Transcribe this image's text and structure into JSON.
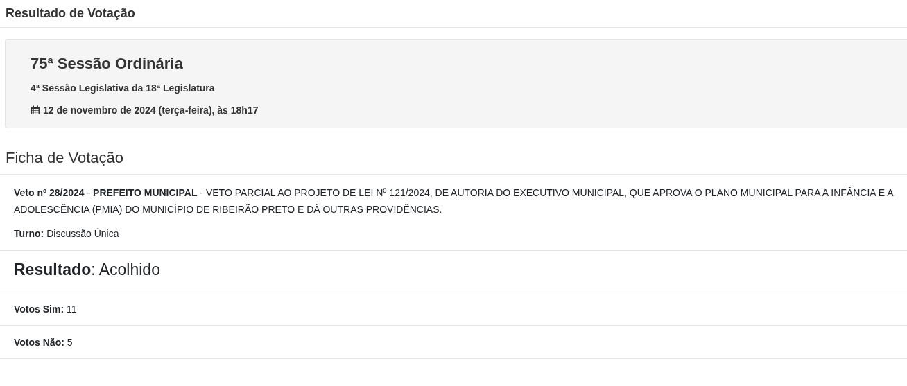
{
  "page_title": "Resultado de Votação",
  "session": {
    "title": "75ª Sessão Ordinária",
    "subtitle": "4ª Sessão Legislativa da 18ª Legislatura",
    "date": "12 de novembro de 2024 (terça-feira), às 18h17"
  },
  "ficha": {
    "title": "Ficha de Votação",
    "description": "**Veto nº 28/2024** - **PREFEITO MUNICIPAL** - VETO PARCIAL AO PROJETO DE LEI Nº 121/2024, DE AUTORIA DO EXECUTIVO MUNICIPAL, QUE APROVA O PLANO MUNICIPAL PARA A INFÂNCIA E A ADOLESCÊNCIA (PMIA) DO MUNICÍPIO DE RIBEIRÃO PRETO E DÁ OUTRAS PROVIDÊNCIAS.",
    "turno": "**Turno:** Discussão Única",
    "resultado": "**Resultado**: Acolhido",
    "votes": [
      {
        "text": "**Votos Sim:** 11"
      },
      {
        "text": "**Votos Não:** 5"
      }
    ]
  }
}
